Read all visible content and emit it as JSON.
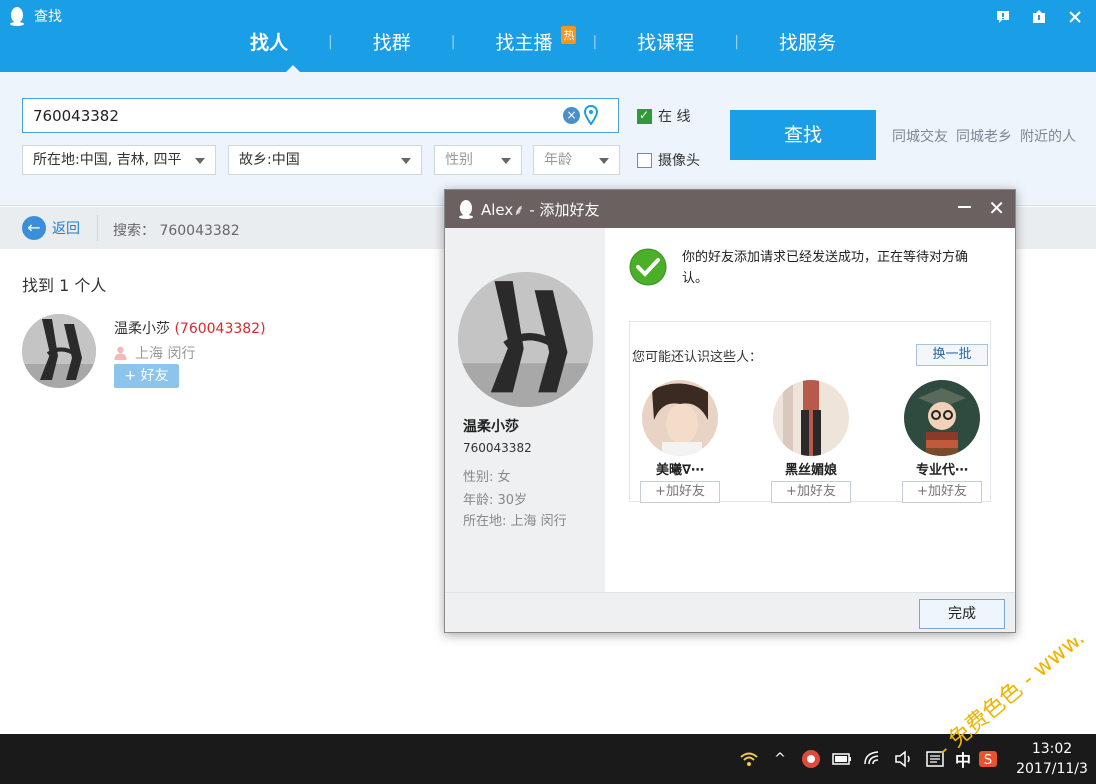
{
  "app": {
    "title": "查找"
  },
  "nav": {
    "tabs": [
      {
        "label": "找人",
        "active": true
      },
      {
        "label": "找群"
      },
      {
        "label": "找主播",
        "badge": "热"
      },
      {
        "label": "找课程"
      },
      {
        "label": "找服务"
      }
    ]
  },
  "window_controls": [
    "feedback-icon",
    "upload-icon",
    "close-icon"
  ],
  "search": {
    "value": "760043382",
    "filters": {
      "location": "所在地:中国, 吉林, 四平",
      "hometown": "故乡:中国",
      "gender": "性别",
      "age": "年龄"
    },
    "online_label": "在  线",
    "online_checked": true,
    "camera_label": "摄像头",
    "camera_checked": false,
    "button": "查找",
    "quick_links": [
      "同城交友",
      "同城老乡",
      "附近的人"
    ]
  },
  "back_bar": {
    "back_label": "返回",
    "search_echo": "搜索： 760043382"
  },
  "results": {
    "count_label": "找到 1 个人",
    "items": [
      {
        "name": "温柔小莎",
        "qq": "(760043382)",
        "location": "上海 闵行",
        "tag": "+ 好友"
      }
    ]
  },
  "dialog": {
    "title": "Alex⸙ - 添加好友",
    "profile": {
      "name": "温柔小莎",
      "qq": "760043382",
      "gender": "性别: 女",
      "age": "年龄: 30岁",
      "location": "所在地: 上海  闵行"
    },
    "message": "你的好友添加请求已经发送成功，正在等待对方确认。",
    "suggest_title": "您可能还认识这些人：",
    "refresh_label": "换一批",
    "suggestions": [
      {
        "name": "美曦∇⋯",
        "add": "+加好友"
      },
      {
        "name": "黑丝媚娘",
        "add": "+加好友"
      },
      {
        "name": "专业代⋯",
        "add": "+加好友"
      }
    ],
    "done_label": "完成"
  },
  "taskbar": {
    "ime": "中",
    "time": "13:02",
    "date": "2017/11/3"
  },
  "watermark": {
    "text": "- 免费色色 - www.MFsese.com"
  },
  "colors": {
    "brand_blue": "#1a9ee6",
    "dialog_title": "#6b6161",
    "qq_red": "#d9282e",
    "success_green": "#4caf2a"
  }
}
